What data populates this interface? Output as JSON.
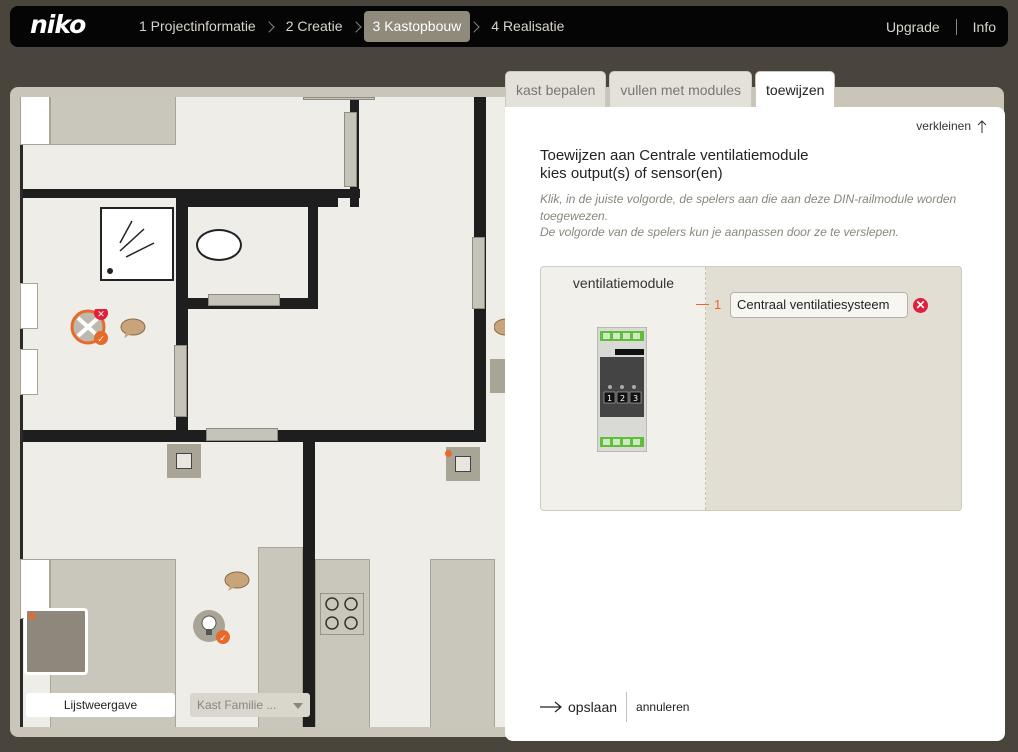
{
  "brand": "niko",
  "nav": {
    "steps": [
      {
        "label": "1 Projectinformatie"
      },
      {
        "label": "2 Creatie"
      },
      {
        "label": "3 Kastopbouw"
      },
      {
        "label": "4 Realisatie"
      }
    ],
    "active_step": 2,
    "upgrade": "Upgrade",
    "info": "Info"
  },
  "tabs": [
    {
      "label": "kast bepalen"
    },
    {
      "label": "vullen met modules"
    },
    {
      "label": "toewijzen"
    }
  ],
  "active_tab": 2,
  "panel": {
    "shrink_label": "verkleinen",
    "title_line1": "Toewijzen aan Centrale ventilatiemodule",
    "title_line2": "kies output(s) of sensor(en)",
    "help_line1": "Klik, in de juiste volgorde, de spelers aan die aan deze DIN-railmodule worden toegewezen.",
    "help_line2": "De volgorde van de spelers kun je aanpassen door ze te verslepen.",
    "module_label": "ventilatiemodule",
    "module_numbers": [
      "1",
      "2",
      "3"
    ],
    "slots": [
      {
        "number": "1",
        "value": "Centraal ventilatiesysteem"
      }
    ],
    "save_label": "opslaan",
    "cancel_label": "annuleren"
  },
  "plan": {
    "list_view_label": "Lijstweergave",
    "family_select": "Kast Familie ..."
  },
  "colors": {
    "accent": "#e86a2a",
    "danger": "#e0203a",
    "active_step_bg": "#8f8a7c"
  }
}
